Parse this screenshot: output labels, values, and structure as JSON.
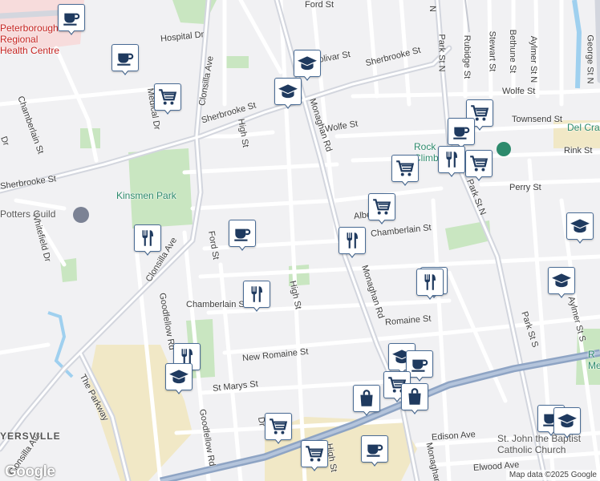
{
  "map": {
    "attribution": "Map data ©2025 Google",
    "logo": "Google",
    "colors": {
      "background": "#f1f1f3",
      "road": "#ffffff",
      "arterial": "#d3d6de",
      "highway": "#8ea4c4",
      "park": "#c9e6c1",
      "industrial": "#f1e8c6",
      "hospital": "#f7dcdc",
      "water": "#9fd0ef",
      "marker_border": "#4a6c95",
      "icon": "#1f3a5f",
      "poi_text": "#2d8a6c",
      "hospital_text": "#c5221f"
    }
  },
  "streets": [
    "Sherbrooke St",
    "Sherbrooke St",
    "Sherbrooke St",
    "Wolfe St",
    "Wolfe St",
    "Hospital Dr",
    "High St",
    "High St",
    "High St",
    "Monaghan Rd",
    "Monaghan Rd",
    "Monaghan Rd",
    "Clonsilla Ave",
    "Clonsilla Ave",
    "Clonsilla Ave",
    "Ford St",
    "Goodfellow Rd",
    "Goodfellow Rd",
    "Chamberlain St",
    "Chamberlain St",
    "Romaine St",
    "New Romaine St",
    "St Marys St",
    "The Parkway",
    "Whitefield Dr",
    "Medical Dr",
    "Park St N",
    "Park St N",
    "Park St S",
    "Rubidge St",
    "Stewart St",
    "Bethune St",
    "Aylmer St N",
    "Aylmer St S",
    "George St N",
    "Townsend St",
    "Rink St",
    "Perry St",
    "Albert St",
    "Edison Ave",
    "Elwood Ave",
    "Chamberlain St",
    "Dr",
    "Dr",
    "Bolivar St",
    "N",
    "Ford St"
  ],
  "pois": {
    "hospital": "Peterborough Regional Health Centre",
    "park": "Kinsmen Park",
    "guild": "Potters Guild",
    "climbing": "Rock Climbing",
    "del": "Del Cra",
    "church": "St. John the Baptist Catholic Church",
    "ville": "YERSVILLE",
    "rm": "R Me"
  },
  "markers": [
    {
      "icon": "coffee-icon"
    },
    {
      "icon": "coffee-icon"
    },
    {
      "icon": "school-icon"
    },
    {
      "icon": "cart-icon"
    },
    {
      "icon": "cart-icon"
    },
    {
      "icon": "school-icon"
    },
    {
      "icon": "cart-icon"
    },
    {
      "icon": "coffee-icon"
    },
    {
      "icon": "cart-icon"
    },
    {
      "icon": "restaurant-icon"
    },
    {
      "icon": "coffee-icon"
    },
    {
      "icon": "cart-icon"
    },
    {
      "icon": "restaurant-icon"
    },
    {
      "icon": "restaurant-icon"
    },
    {
      "icon": "restaurant-icon"
    },
    {
      "icon": "restaurant-icon"
    },
    {
      "icon": "school-icon"
    },
    {
      "icon": "school-icon"
    },
    {
      "icon": "restaurant-icon"
    },
    {
      "icon": "restaurant-icon"
    },
    {
      "icon": "school-icon"
    },
    {
      "icon": "school-icon"
    },
    {
      "icon": "coffee-icon"
    },
    {
      "icon": "cart-icon"
    },
    {
      "icon": "shopping-bag-icon"
    },
    {
      "icon": "shopping-bag-icon"
    },
    {
      "icon": "cart-icon"
    },
    {
      "icon": "cart-icon"
    },
    {
      "icon": "coffee-icon"
    },
    {
      "icon": "coffee-icon"
    },
    {
      "icon": "school-icon"
    }
  ]
}
